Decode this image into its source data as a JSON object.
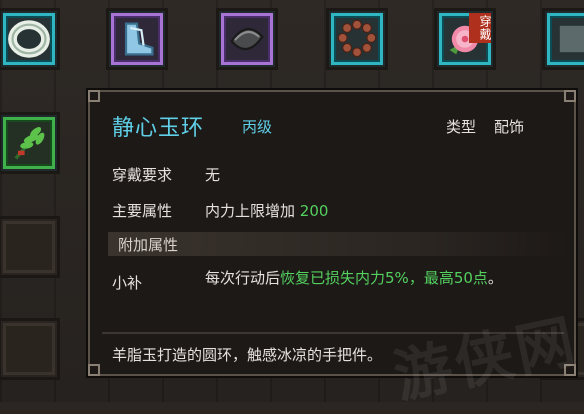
{
  "slots_top": [
    {
      "icon": "jade-ring-icon",
      "rarity": "cyan"
    },
    {
      "icon": "boots-icon",
      "rarity": "purple"
    },
    {
      "icon": "dark-seed-icon",
      "rarity": "purple"
    },
    {
      "icon": "prayer-beads-icon",
      "rarity": "cyan"
    },
    {
      "icon": "peony-flower-icon",
      "rarity": "cyan",
      "worn": true
    },
    {
      "icon": "item-icon",
      "rarity": "cyan"
    }
  ],
  "worn_badge": "穿戴",
  "slot_left": {
    "icon": "herb-bundle-icon",
    "rarity": "green"
  },
  "item": {
    "name": "静心玉环",
    "grade": "丙级",
    "type_label": "类型",
    "type_value": "配饰",
    "req_label": "穿戴要求",
    "req_value": "无",
    "attr_label": "主要属性",
    "attr_text": "内力上限增加",
    "attr_value": "200",
    "section_title": "附加属性",
    "bonus_name": "小补",
    "bonus_prefix": "每次行动后",
    "bonus_highlight": "恢复已损失内力5%，最高50点",
    "bonus_suffix": "。",
    "flavor": "羊脂玉打造的圆环，触感冰凉的手把件。"
  },
  "watermark": "游侠网",
  "colors": {
    "cyan": "#2fb6c0",
    "purple": "#a774d6",
    "green": "#3fb04a",
    "name": "#5fd0e8",
    "value_green": "#53d05e"
  }
}
